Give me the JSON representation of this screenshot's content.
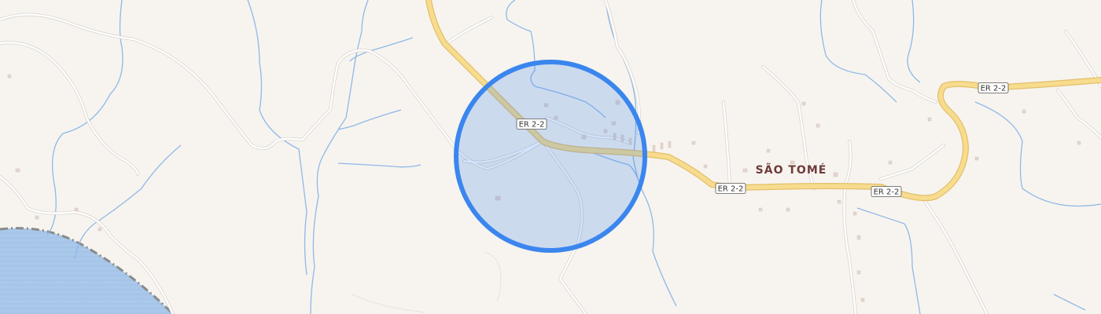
{
  "map": {
    "place_label": "SÃO TOMÉ",
    "road_shields": [
      {
        "id": "shield-1",
        "label": "ER 2-2"
      },
      {
        "id": "shield-2",
        "label": "ER 2-2"
      },
      {
        "id": "shield-3",
        "label": "ER 2-2"
      },
      {
        "id": "shield-4",
        "label": "ER 2-2"
      }
    ],
    "colors": {
      "land": "#f7f4ef",
      "water": "#a9c8ea",
      "stream": "#8fb8e8",
      "minor_road": "#ffffff",
      "major_road_fill": "#f7dc8e",
      "major_road_casing": "#e3bf6b",
      "selection_fill": "#c8d9f2",
      "selection_stroke": "#3b86ee",
      "boundary": "#8a8a8a",
      "place_label": "#6e3b3b"
    }
  }
}
